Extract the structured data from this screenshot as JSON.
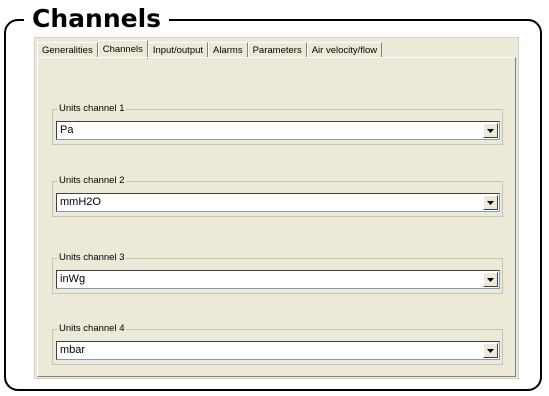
{
  "title": "Channels",
  "tabs": [
    {
      "label": "Generalities"
    },
    {
      "label": "Channels"
    },
    {
      "label": "Input/output"
    },
    {
      "label": "Alarms"
    },
    {
      "label": "Parameters"
    },
    {
      "label": "Air velocity/flow"
    }
  ],
  "active_tab": "Channels",
  "channels": [
    {
      "label": "Units channel 1",
      "value": "Pa"
    },
    {
      "label": "Units channel 2",
      "value": "mmH2O"
    },
    {
      "label": "Units channel 3",
      "value": "inWg"
    },
    {
      "label": "Units channel 4",
      "value": "mbar"
    }
  ]
}
